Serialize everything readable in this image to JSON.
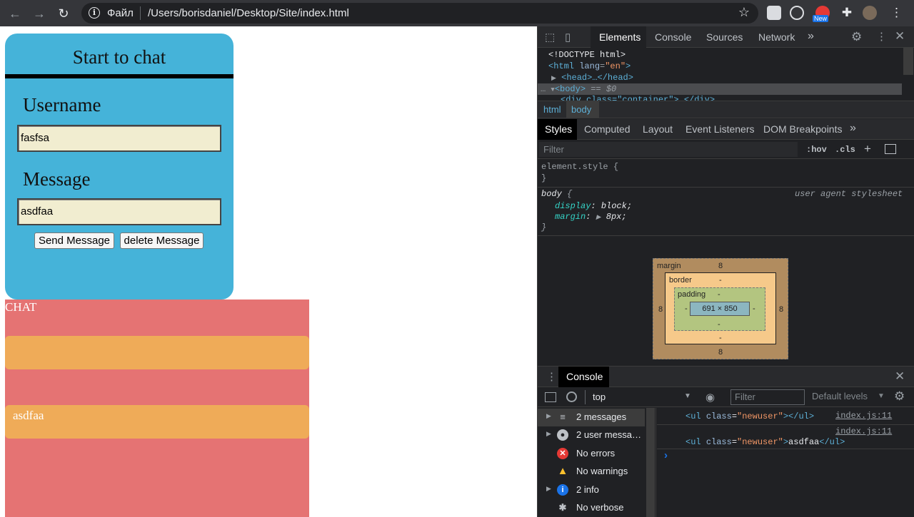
{
  "browser": {
    "scheme_label": "Файл",
    "url": "/Users/borisdaniel/Desktop/Site/index.html",
    "ext_badge": "New",
    "info_glyph": "i",
    "back_glyph": "←",
    "forward_glyph": "→",
    "reload_glyph": "↻",
    "star_glyph": "☆",
    "menu_glyph": "⋮"
  },
  "page": {
    "title": "Start to chat",
    "username_label": "Username",
    "username_value": "fasfsa",
    "message_label": "Message",
    "message_value": "asdfaa",
    "send_button": "Send Message",
    "delete_button": "delete Message",
    "chat_heading": "CHAT",
    "messages": [
      "",
      "asdfaa"
    ]
  },
  "devtools": {
    "tabs": [
      "Elements",
      "Console",
      "Sources",
      "Network",
      "»"
    ],
    "active_tab": "Elements",
    "dom": {
      "doctype": "<!DOCTYPE html>",
      "html_open_tag": "<html",
      "html_attr": "lang",
      "html_attr_val": "\"en\"",
      "html_close": ">",
      "head_line": "<head>…</head>",
      "body_line": "<body>",
      "body_marker": "== $0",
      "div_line": "<div class=\"container\">…</div>"
    },
    "breadcrumbs": [
      "html",
      "body"
    ],
    "style_tabs": [
      "Styles",
      "Computed",
      "Layout",
      "Event Listeners",
      "DOM Breakpoints",
      "»"
    ],
    "filter_placeholder": "Filter",
    "hov": ":hov",
    "cls": ".cls",
    "plus": "+",
    "element_style_open": "element.style {",
    "element_style_close": "}",
    "body_rule": {
      "selector": "body",
      "open": "{",
      "source": "user agent stylesheet",
      "prop1": "display",
      "val1": "block;",
      "prop2": "margin",
      "val2": "8px;",
      "close": "}"
    },
    "box_model": {
      "margin_label": "margin",
      "margin_top": "8",
      "margin_bottom": "8",
      "margin_left": "8",
      "margin_right": "8",
      "border_label": "border",
      "border_top": "-",
      "border_bottom": "-",
      "padding_label": "padding",
      "padding_top": "-",
      "padding_bottom": "-",
      "padding_left": "-",
      "padding_right": "-",
      "content": "691 × 850"
    },
    "console": {
      "title": "Console",
      "context": "top",
      "filter_placeholder": "Filter",
      "levels": "Default levels",
      "sidebar": [
        {
          "label": "2 messages",
          "icon": "list-icon"
        },
        {
          "label": "2 user messa…",
          "icon": "user-icon"
        },
        {
          "label": "No errors",
          "icon": "error-icon"
        },
        {
          "label": "No warnings",
          "icon": "warning-icon"
        },
        {
          "label": "2 info",
          "icon": "info-icon"
        },
        {
          "label": "No verbose",
          "icon": "bug-icon"
        }
      ],
      "logs": [
        {
          "tag_open": "<ul",
          "attr": "class",
          "val": "\"newuser\"",
          "close": ">",
          "text": "",
          "end": "</ul>",
          "source": "index.js:11"
        },
        {
          "tag_open": "<ul",
          "attr": "class",
          "val": "\"newuser\"",
          "close": ">",
          "text": "asdfaa",
          "end": "</ul>",
          "source": "index.js:11"
        }
      ],
      "prompt": "›"
    }
  }
}
